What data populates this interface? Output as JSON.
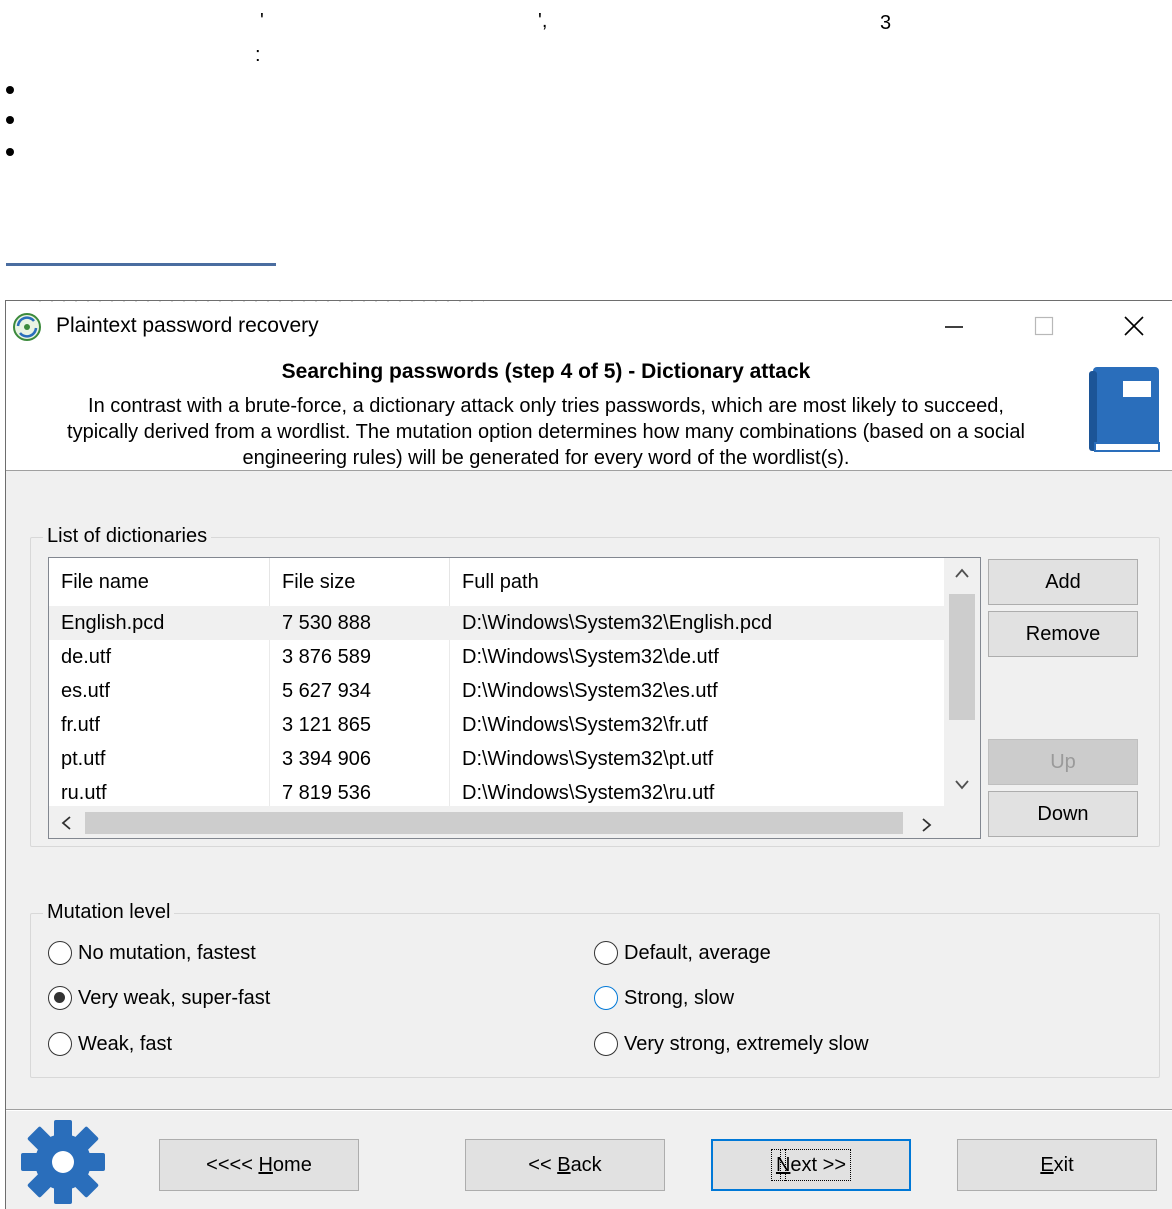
{
  "article": {
    "fragments": [
      "'",
      "',",
      "3",
      ":"
    ],
    "bullets": 3
  },
  "window": {
    "title": "Plaintext password recovery",
    "controls": {
      "minimize": "—",
      "maximize": "☐",
      "close": "✕"
    }
  },
  "header": {
    "title": "Searching passwords (step 4 of 5) - Dictionary attack",
    "description_lines": [
      "In contrast with a brute-force, a dictionary attack only tries passwords, which are most likely to succeed,",
      "typically derived from a wordlist. The mutation option determines how many combinations (based on a social",
      "engineering rules)  will be generated for every word of the wordlist(s)."
    ]
  },
  "dictionaries": {
    "group_label": "List of dictionaries",
    "columns": [
      "File name",
      "File size",
      "Full path"
    ],
    "rows": [
      {
        "name": "English.pcd",
        "size": "7 530 888",
        "path": "D:\\Windows\\System32\\English.pcd",
        "selected": true
      },
      {
        "name": "de.utf",
        "size": "3 876 589",
        "path": "D:\\Windows\\System32\\de.utf"
      },
      {
        "name": "es.utf",
        "size": "5 627 934",
        "path": "D:\\Windows\\System32\\es.utf"
      },
      {
        "name": "fr.utf",
        "size": "3 121 865",
        "path": "D:\\Windows\\System32\\fr.utf"
      },
      {
        "name": "pt.utf",
        "size": "3 394 906",
        "path": "D:\\Windows\\System32\\pt.utf"
      },
      {
        "name": "ru.utf",
        "size": "7 819 536",
        "path": "D:\\Windows\\System32\\ru.utf"
      }
    ],
    "buttons": {
      "add": "Add",
      "remove": "Remove",
      "up": "Up",
      "down": "Down"
    }
  },
  "mutation": {
    "group_label": "Mutation level",
    "options": [
      {
        "label": "No mutation, fastest",
        "checked": false
      },
      {
        "label": "Very weak, super-fast",
        "checked": true
      },
      {
        "label": "Weak, fast",
        "checked": false
      },
      {
        "label": "Default, average",
        "checked": false
      },
      {
        "label": "Strong, slow",
        "checked": false,
        "focused": true
      },
      {
        "label": "Very strong, extremely slow",
        "checked": false
      }
    ]
  },
  "footer": {
    "buttons": {
      "home": {
        "pre": "<<<< ",
        "key": "H",
        "post": "ome"
      },
      "back": {
        "pre": "<< ",
        "key": "B",
        "post": "ack"
      },
      "next": {
        "pre": "",
        "key": "N",
        "post": "ext >>"
      },
      "exit": {
        "pre": "",
        "key": "E",
        "post": "xit"
      }
    }
  },
  "colors": {
    "accent": "#0078d7",
    "icon_blue": "#2a6ebb",
    "article_rule": "#4a6da0"
  }
}
